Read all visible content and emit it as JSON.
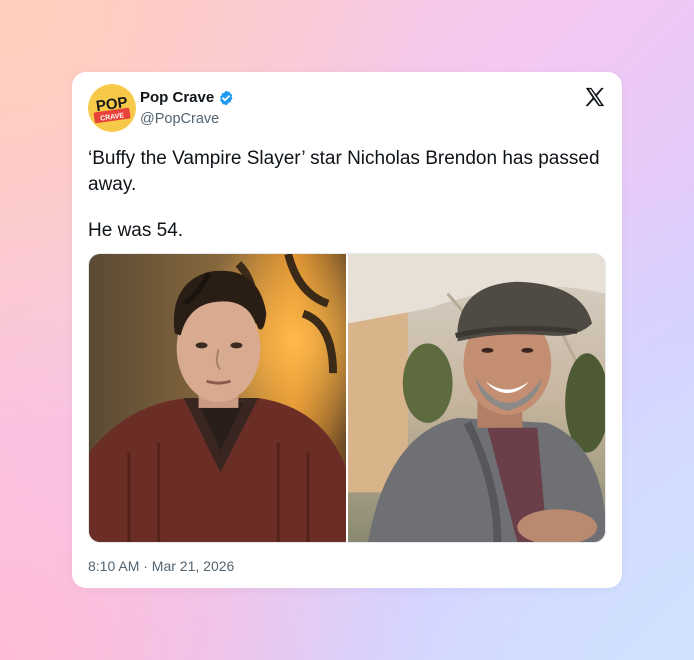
{
  "author": {
    "display_name": "Pop Crave",
    "handle": "@PopCrave",
    "verified": true,
    "avatar_text_top": "POP",
    "avatar_text_bottom": "CRAVE"
  },
  "platform_logo": "x-logo-icon",
  "tweet": {
    "lines": [
      "‘Buffy the Vampire Slayer’ star Nicholas Brendon has passed away.",
      "He was 54."
    ]
  },
  "media": [
    {
      "name": "photo-left",
      "subject": "young man with dark wavy hair in a brown cable-knit sweater"
    },
    {
      "name": "photo-right",
      "subject": "smiling man in a flat cap and grey cardigan outdoors"
    }
  ],
  "timestamp": "8:10 AM · Mar 21, 2026",
  "colors": {
    "text_primary": "#0f1419",
    "text_secondary": "#536471",
    "verified_blue": "#1d9bf0",
    "avatar_bg": "#f7c948",
    "avatar_accent": "#e8443a"
  }
}
